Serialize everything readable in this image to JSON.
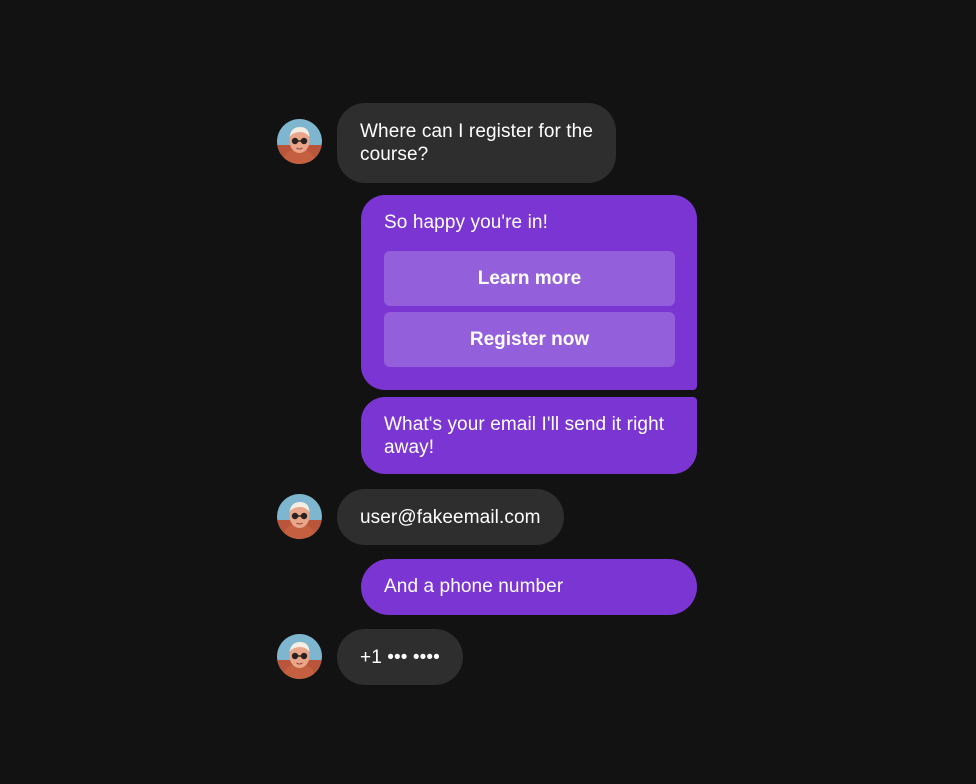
{
  "conversation": {
    "messages": [
      {
        "sender": "user",
        "text": "Where can I register for the course?"
      },
      {
        "sender": "bot",
        "text": "So happy you're in!",
        "buttons": [
          "Learn more",
          "Register now"
        ]
      },
      {
        "sender": "bot",
        "text": "What's your email I'll send it right away!"
      },
      {
        "sender": "user",
        "text": "user@fakeemail.com"
      },
      {
        "sender": "bot",
        "text": "And a phone number"
      },
      {
        "sender": "user",
        "text": "+1 ••• ••••"
      }
    ]
  },
  "colors": {
    "background": "#121212",
    "user_bubble": "#2e2e2e",
    "bot_bubble": "#7b35d2",
    "bot_button": "#945fda",
    "text": "#ffffff"
  },
  "icons": {
    "user_avatar": "avatar-photo-person-with-sunglasses"
  }
}
